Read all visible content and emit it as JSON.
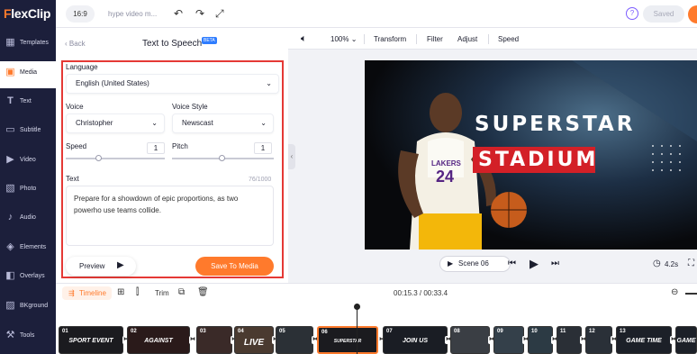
{
  "app": {
    "logo_part1": "F",
    "logo_part2": "lexClip"
  },
  "sidebar": {
    "items": [
      {
        "label": "Templates",
        "icon": "templates-icon"
      },
      {
        "label": "Media",
        "icon": "media-icon",
        "active": true
      },
      {
        "label": "Text",
        "icon": "text-icon"
      },
      {
        "label": "Subtitle",
        "icon": "subtitle-icon"
      },
      {
        "label": "Video",
        "icon": "video-icon"
      },
      {
        "label": "Photo",
        "icon": "photo-icon"
      },
      {
        "label": "Audio",
        "icon": "audio-icon"
      },
      {
        "label": "Elements",
        "icon": "elements-icon"
      },
      {
        "label": "Overlays",
        "icon": "overlays-icon"
      },
      {
        "label": "BKground",
        "icon": "background-icon"
      },
      {
        "label": "Tools",
        "icon": "tools-icon"
      }
    ]
  },
  "topbar": {
    "ratio": "16:9",
    "project_name": "hype video m...",
    "saved_label": "Saved",
    "help": "?"
  },
  "panel": {
    "back_label": "Back",
    "title": "Text to Speech",
    "badge": "BETA",
    "language_label": "Language",
    "language_value": "English (United States)",
    "voice_label": "Voice",
    "voice_value": "Christopher",
    "voice_style_label": "Voice Style",
    "voice_style_value": "Newscast",
    "speed_label": "Speed",
    "speed_value": "1",
    "pitch_label": "Pitch",
    "pitch_value": "1",
    "text_label": "Text",
    "char_count": "76/1000",
    "text_value": "Prepare for a showdown of epic proportions, as two powerho use teams collide.",
    "preview_label": "Preview",
    "save_label": "Save To Media"
  },
  "editor_toolbar": {
    "zoom": "100%",
    "transform": "Transform",
    "filter": "Filter",
    "adjust": "Adjust",
    "speed": "Speed"
  },
  "video": {
    "title_line1": "SUPERSTAR",
    "title_line2": "STADIUM",
    "jersey_team": "LAKERS",
    "jersey_number": "24"
  },
  "player": {
    "scene_label": "Scene 06",
    "duration": "4.2s"
  },
  "timeline": {
    "label": "Timeline",
    "trim_label": "Trim",
    "time": "00:15.3 / 00:33.4",
    "clips": [
      {
        "num": "01",
        "caption": "SPORT EVENT",
        "color": "#1a1a22"
      },
      {
        "num": "02",
        "caption": "AGAINST",
        "color": "#2a1a1a"
      },
      {
        "num": "03",
        "caption": "",
        "color": "#3a2a28"
      },
      {
        "num": "04",
        "caption": "LIVE",
        "color": "#4a3a30"
      },
      {
        "num": "05",
        "caption": "",
        "color": "#2b3036"
      },
      {
        "num": "06",
        "caption": "SUPERSTAR",
        "color": "#222"
      },
      {
        "num": "07",
        "caption": "JOIN US",
        "color": "#1a1d24"
      },
      {
        "num": "08",
        "caption": "",
        "color": "#3a3e44"
      },
      {
        "num": "09",
        "caption": "",
        "color": "#34404a"
      },
      {
        "num": "10",
        "caption": "",
        "color": "#2c3a44"
      },
      {
        "num": "11",
        "caption": "",
        "color": "#2a2f36"
      },
      {
        "num": "12",
        "caption": "",
        "color": "#2a3038"
      },
      {
        "num": "13",
        "caption": "GAME TIME",
        "color": "#1c2028"
      },
      {
        "num": "",
        "caption": "GAME",
        "color": "#1c2028"
      }
    ]
  },
  "colors": {
    "accent": "#ff7a2c",
    "sidebar_bg": "#1c1f3b",
    "highlight_box": "#e53935",
    "beta_badge": "#2f7dff",
    "title_banner": "#d32027"
  }
}
